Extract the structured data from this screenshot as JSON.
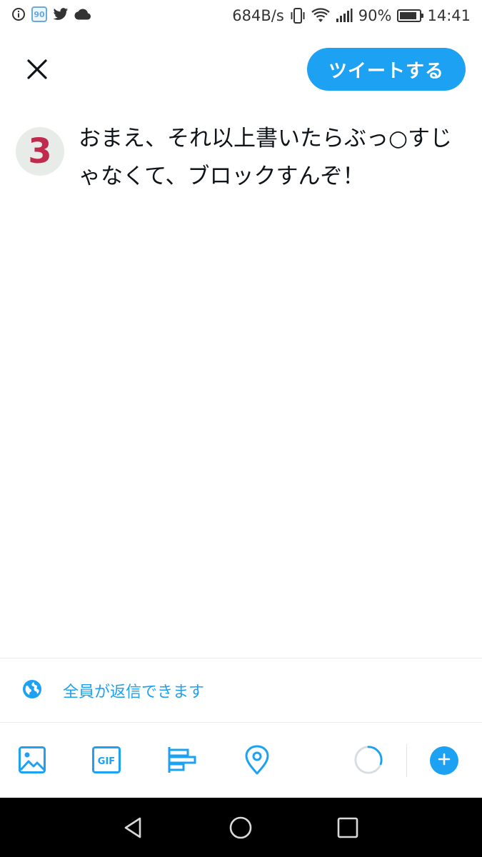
{
  "status_bar": {
    "icons_left": [
      "info-icon",
      "app-90-icon",
      "twitter-icon",
      "cloud-icon"
    ],
    "app_badge": "90",
    "net_speed": "684B/s",
    "battery_percent": "90%",
    "battery_level": 0.9,
    "time": "14:41"
  },
  "header": {
    "close_icon": "close-icon",
    "tweet_button_label": "ツイートする"
  },
  "composer": {
    "avatar_text": "3",
    "tweet_text": "おまえ、それ以上書いたらぶっ○すじゃなくて、ブロックすんぞ！"
  },
  "reply_setting": {
    "icon": "globe-icon",
    "label": "全員が返信できます"
  },
  "toolbar": {
    "items": [
      "image-icon",
      "gif-icon",
      "poll-icon",
      "location-icon"
    ],
    "gif_label": "GIF",
    "character_progress": 0.3,
    "add_icon": "plus-icon"
  },
  "colors": {
    "accent": "#1da1f2",
    "text": "#0f1419",
    "avatar_digit": "#c02a4c",
    "nav_bg": "#000000"
  }
}
